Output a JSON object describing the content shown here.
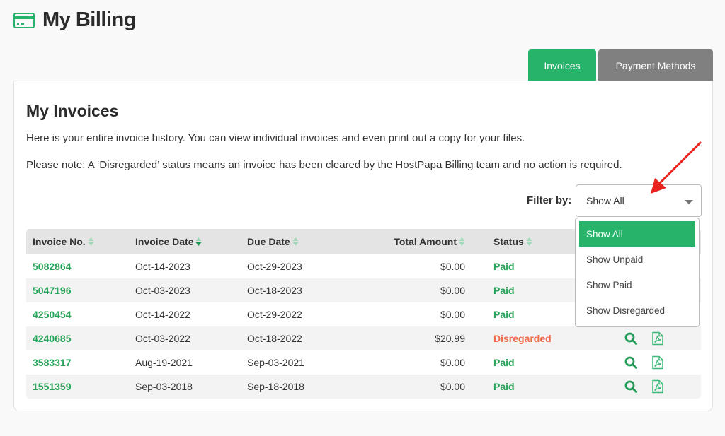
{
  "header": {
    "title": "My Billing",
    "icon": "credit-card-icon"
  },
  "tabs": [
    {
      "label": "Invoices",
      "active": true
    },
    {
      "label": "Payment Methods",
      "active": false
    }
  ],
  "section": {
    "title": "My Invoices",
    "description": "Here is your entire invoice history. You can view individual invoices and even print out a copy for your files.",
    "note": "Please note: A ‘Disregarded’ status means an invoice has been cleared by the HostPapa Billing team and no action is required."
  },
  "filter": {
    "label": "Filter by:",
    "selected": "Show All",
    "options": [
      "Show All",
      "Show Unpaid",
      "Show Paid",
      "Show Disregarded"
    ]
  },
  "table": {
    "columns": [
      "Invoice No.",
      "Invoice Date",
      "Due Date",
      "Total Amount",
      "Status"
    ],
    "rows": [
      {
        "invoice_no": "5082864",
        "invoice_date": "Oct-14-2023",
        "due_date": "Oct-29-2023",
        "total": "$0.00",
        "status": "Paid"
      },
      {
        "invoice_no": "5047196",
        "invoice_date": "Oct-03-2023",
        "due_date": "Oct-18-2023",
        "total": "$0.00",
        "status": "Paid"
      },
      {
        "invoice_no": "4250454",
        "invoice_date": "Oct-14-2022",
        "due_date": "Oct-29-2022",
        "total": "$0.00",
        "status": "Paid"
      },
      {
        "invoice_no": "4240685",
        "invoice_date": "Oct-03-2022",
        "due_date": "Oct-18-2022",
        "total": "$20.99",
        "status": "Disregarded"
      },
      {
        "invoice_no": "3583317",
        "invoice_date": "Aug-19-2021",
        "due_date": "Sep-03-2021",
        "total": "$0.00",
        "status": "Paid"
      },
      {
        "invoice_no": "1551359",
        "invoice_date": "Sep-03-2018",
        "due_date": "Sep-18-2018",
        "total": "$0.00",
        "status": "Paid"
      }
    ],
    "row_actions": [
      "view-invoice-icon",
      "download-pdf-icon"
    ]
  },
  "colors": {
    "brand_green": "#27b36a",
    "inactive_tab": "#808080",
    "paid": "#27a35a",
    "disregarded": "#f26a4b",
    "annotation_arrow": "#e8231f"
  }
}
